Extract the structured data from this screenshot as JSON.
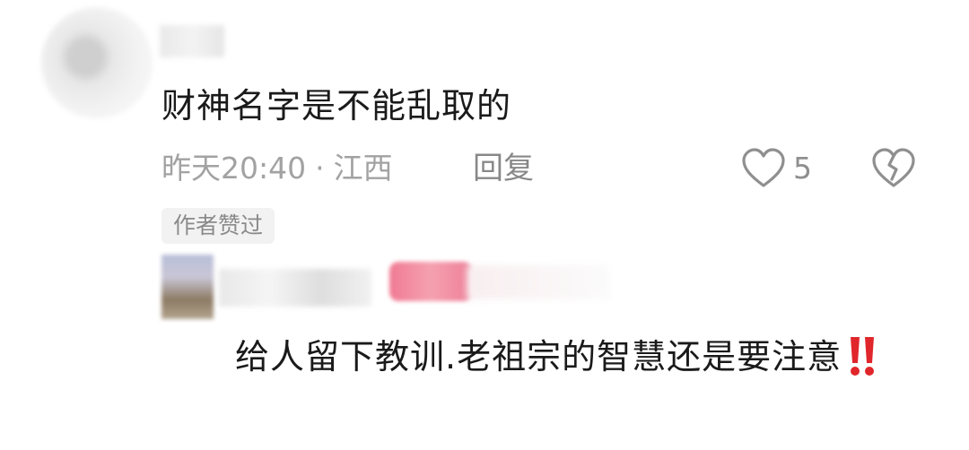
{
  "comment": {
    "text": "财神名字是不能乱取的",
    "time": "昨天20:40",
    "separator": "·",
    "location": "江西",
    "reply_label": "回复",
    "like_count": "5",
    "author_liked_tag": "作者赞过"
  },
  "reply": {
    "text": "给人留下教训.老祖宗的智慧还是要注意"
  },
  "icons": {
    "like": "heart-outline-icon",
    "dislike": "broken-heart-icon",
    "emphasis": "double-exclamation-icon"
  },
  "colors": {
    "text": "#1a1a1a",
    "meta": "#a2a2a2",
    "emphasis": "#e0262b",
    "tag_bg": "#f2f2f2"
  }
}
